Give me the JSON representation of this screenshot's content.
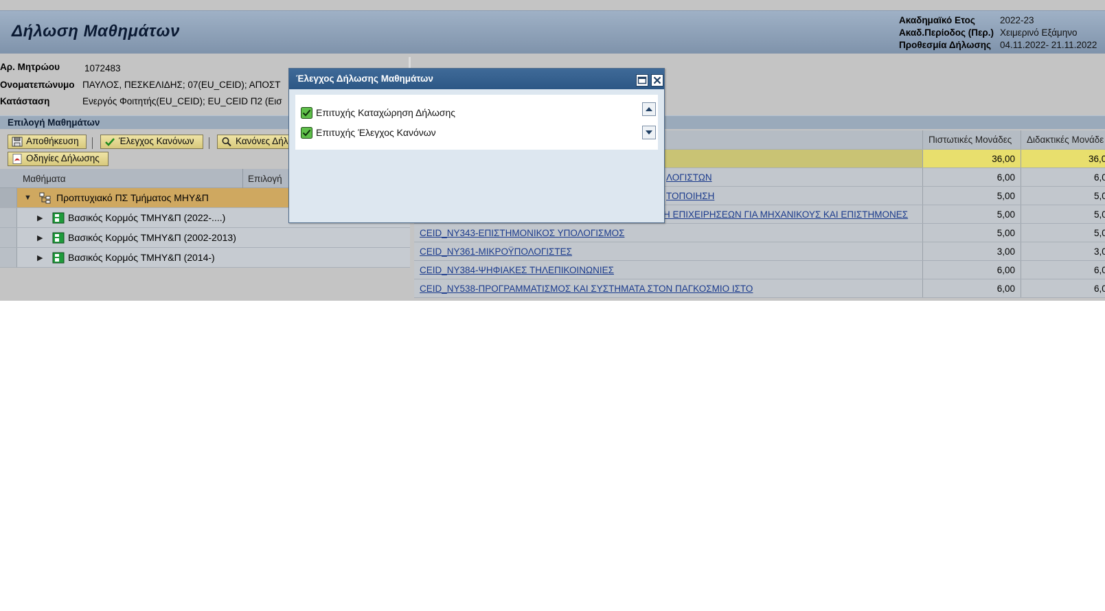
{
  "header": {
    "title": "Δήλωση Μαθημάτων",
    "period": [
      {
        "label": "Ακαδημαϊκό Ετος",
        "value": "2022-23"
      },
      {
        "label": "Ακαδ.Περίοδος (Περ.)",
        "value": "Χειμερινό Εξάμηνο"
      },
      {
        "label": "Προθεσμία Δήλωσης",
        "value": "04.11.2022- 21.11.2022"
      }
    ]
  },
  "student": {
    "am_label": "Αρ. Μητρώου",
    "am_value": "1072483",
    "name_label": "Ονοματεπώνυμο",
    "name_value": "ΠΑΥΛΟΣ, ΠΕΣΚΕΛΙΔΗΣ; 07(EU_CEID); ΑΠΟΣΤ",
    "status_label": "Κατάσταση",
    "status_value": "Ενεργός Φοιτητής(EU_CEID); EU_CEID Π2 (Εισ"
  },
  "section": {
    "title": "Επιλογή Μαθημάτων"
  },
  "toolbar": {
    "save": "Αποθήκευση",
    "check_rules": "Έλεγχος Κανόνων",
    "rules": "Κανόνες Δήλ",
    "instructions": "Οδηγίες Δήλωσης"
  },
  "tree": {
    "col_courses": "Μαθήματα",
    "col_selection": "Επιλογή",
    "root": "Προπτυχιακό ΠΣ Τμήματος ΜΗΥ&Π",
    "children": [
      "Βασικός Κορμός ΤΜΗΥ&Π (2022-....)",
      "Βασικός Κορμός ΤΜΗΥ&Π (2002-2013)",
      "Βασικός Κορμός ΤΜΗΥ&Π (2014-)"
    ]
  },
  "grid": {
    "col_credits": "Πιστωτικές Μονάδες",
    "col_teaching": "Διδακτικές Μονάδε",
    "total": {
      "credits": "36,00",
      "teaching": "36,0"
    },
    "rows": [
      {
        "name": "ΛΟΓΙΣΤΩΝ",
        "credits": "6,00",
        "teaching": "6,0"
      },
      {
        "name": "ΤΟΠΟΙΗΣΗ",
        "credits": "5,00",
        "teaching": "5,0"
      },
      {
        "name": "Η ΕΠΙΧΕΙΡΗΣΕΩΝ ΓΙΑ ΜΗΧΑΝΙΚΟΥΣ ΚΑΙ ΕΠΙΣΤΗΜΟΝΕΣ",
        "credits": "5,00",
        "teaching": "5,0"
      },
      {
        "name": "CEID_NY343-ΕΠΙΣΤΗΜΟΝΙΚΟΣ ΥΠΟΛΟΓΙΣΜΟΣ",
        "credits": "5,00",
        "teaching": "5,0"
      },
      {
        "name": "CEID_NY361-ΜΙΚΡΟΫΠΟΛΟΓΙΣΤΕΣ",
        "credits": "3,00",
        "teaching": "3,0"
      },
      {
        "name": "CEID_NY384-ΨΗΦΙΑΚΕΣ ΤΗΛΕΠΙΚΟΙΝΩΝΙΕΣ",
        "credits": "6,00",
        "teaching": "6,0"
      },
      {
        "name": "CEID_NY538-ΠΡΟΓΡΑΜΜΑΤΙΣΜΟΣ ΚΑΙ ΣΥΣΤΗΜΑΤΑ ΣΤΟΝ ΠΑΓΚΟΣΜΙΟ ΙΣΤΟ",
        "credits": "6,00",
        "teaching": "6,0"
      }
    ]
  },
  "modal": {
    "title": "Έλεγχος Δήλωσης Μαθημάτων",
    "messages": [
      "Επιτυχής Καταχώρηση Δήλωσης",
      "Επιτυχής Έλεγχος Κανόνων"
    ]
  },
  "colors": {
    "header": "#8a9db4",
    "modal_title": "#2f5a89",
    "button": "#e3d58f",
    "selected_row": "#cfa860",
    "total_row": "#e8df6d",
    "success": "#2e8b2e"
  },
  "icons": {
    "save": "floppy-icon",
    "check_rules": "check-icon",
    "rules": "magnifier-icon",
    "instructions": "pdf-icon",
    "tree_root": "hierarchy-icon",
    "tree_child": "course-module-icon",
    "modal_max": "maximize-icon",
    "modal_close": "close-icon",
    "message": "checkbox-success-icon"
  }
}
